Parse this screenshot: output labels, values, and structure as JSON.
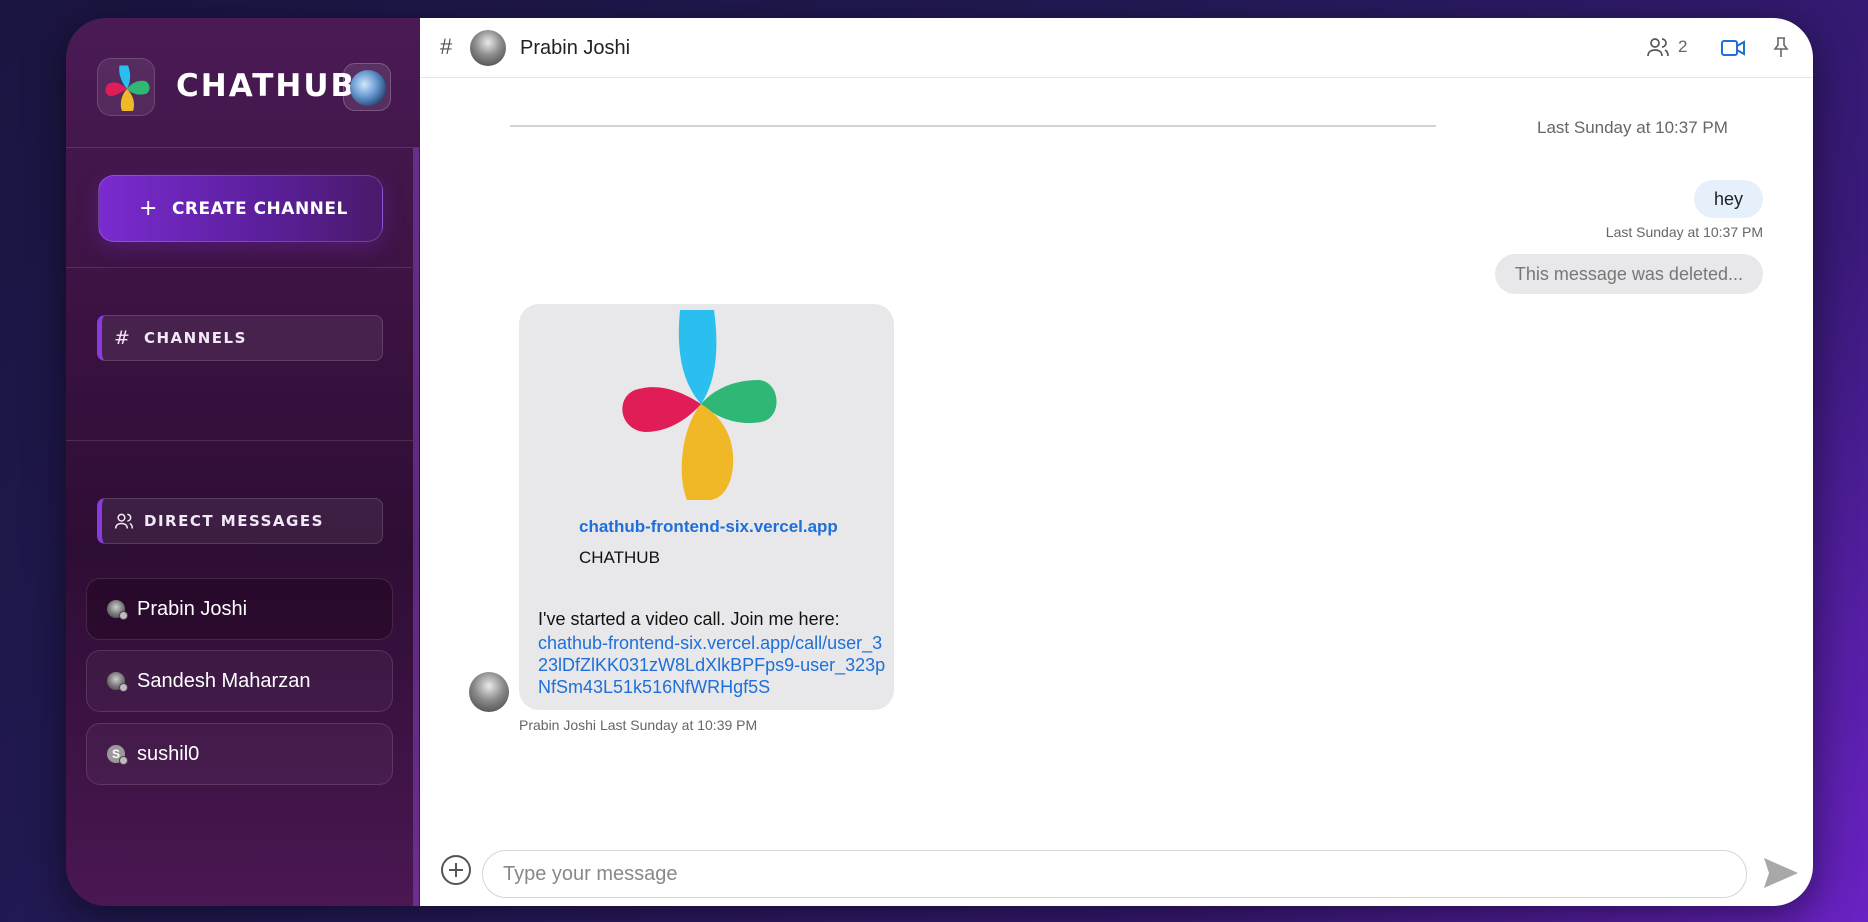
{
  "brand": {
    "title": "CHATHUB"
  },
  "sidebar": {
    "create_label": "CREATE CHANNEL",
    "create_icon": "plus-icon",
    "channels_label": "CHANNELS",
    "dm_label": "DIRECT MESSAGES",
    "dms": [
      {
        "name": "Prabin Joshi",
        "active": true
      },
      {
        "name": "Sandesh Maharzan",
        "active": false
      },
      {
        "name": "sushil0",
        "initial": "S",
        "active": false
      }
    ]
  },
  "header": {
    "channel_name": "Prabin Joshi",
    "member_count": "2",
    "icons": [
      "hash-icon",
      "users-icon",
      "video-icon",
      "pin-icon"
    ]
  },
  "messages": {
    "date_separator": "Last Sunday at 10:37 PM",
    "mine": {
      "text": "hey",
      "time": "Last Sunday at 10:37 PM"
    },
    "deleted_text": "This message was deleted...",
    "card": {
      "link_title": "chathub-frontend-six.vercel.app",
      "site_name": "CHATHUB",
      "text": "I've started a video call. Join me here:",
      "url": "chathub-frontend-six.vercel.app/call/user_323lDfZlKK031zW8LdXlkBPFps9-user_323pNfSm43L51k516NfWRHgf5S",
      "author": "Prabin Joshi",
      "time": "Last Sunday at 10:39 PM"
    }
  },
  "composer": {
    "placeholder": "Type your message"
  },
  "colors": {
    "accent": "#7a2bd0",
    "link": "#1e6fd9",
    "video_icon": "#1e6fd9",
    "logo_blue": "#2bbff0",
    "logo_green": "#2fb875",
    "logo_red": "#e11d58",
    "logo_yellow": "#f0b826"
  }
}
